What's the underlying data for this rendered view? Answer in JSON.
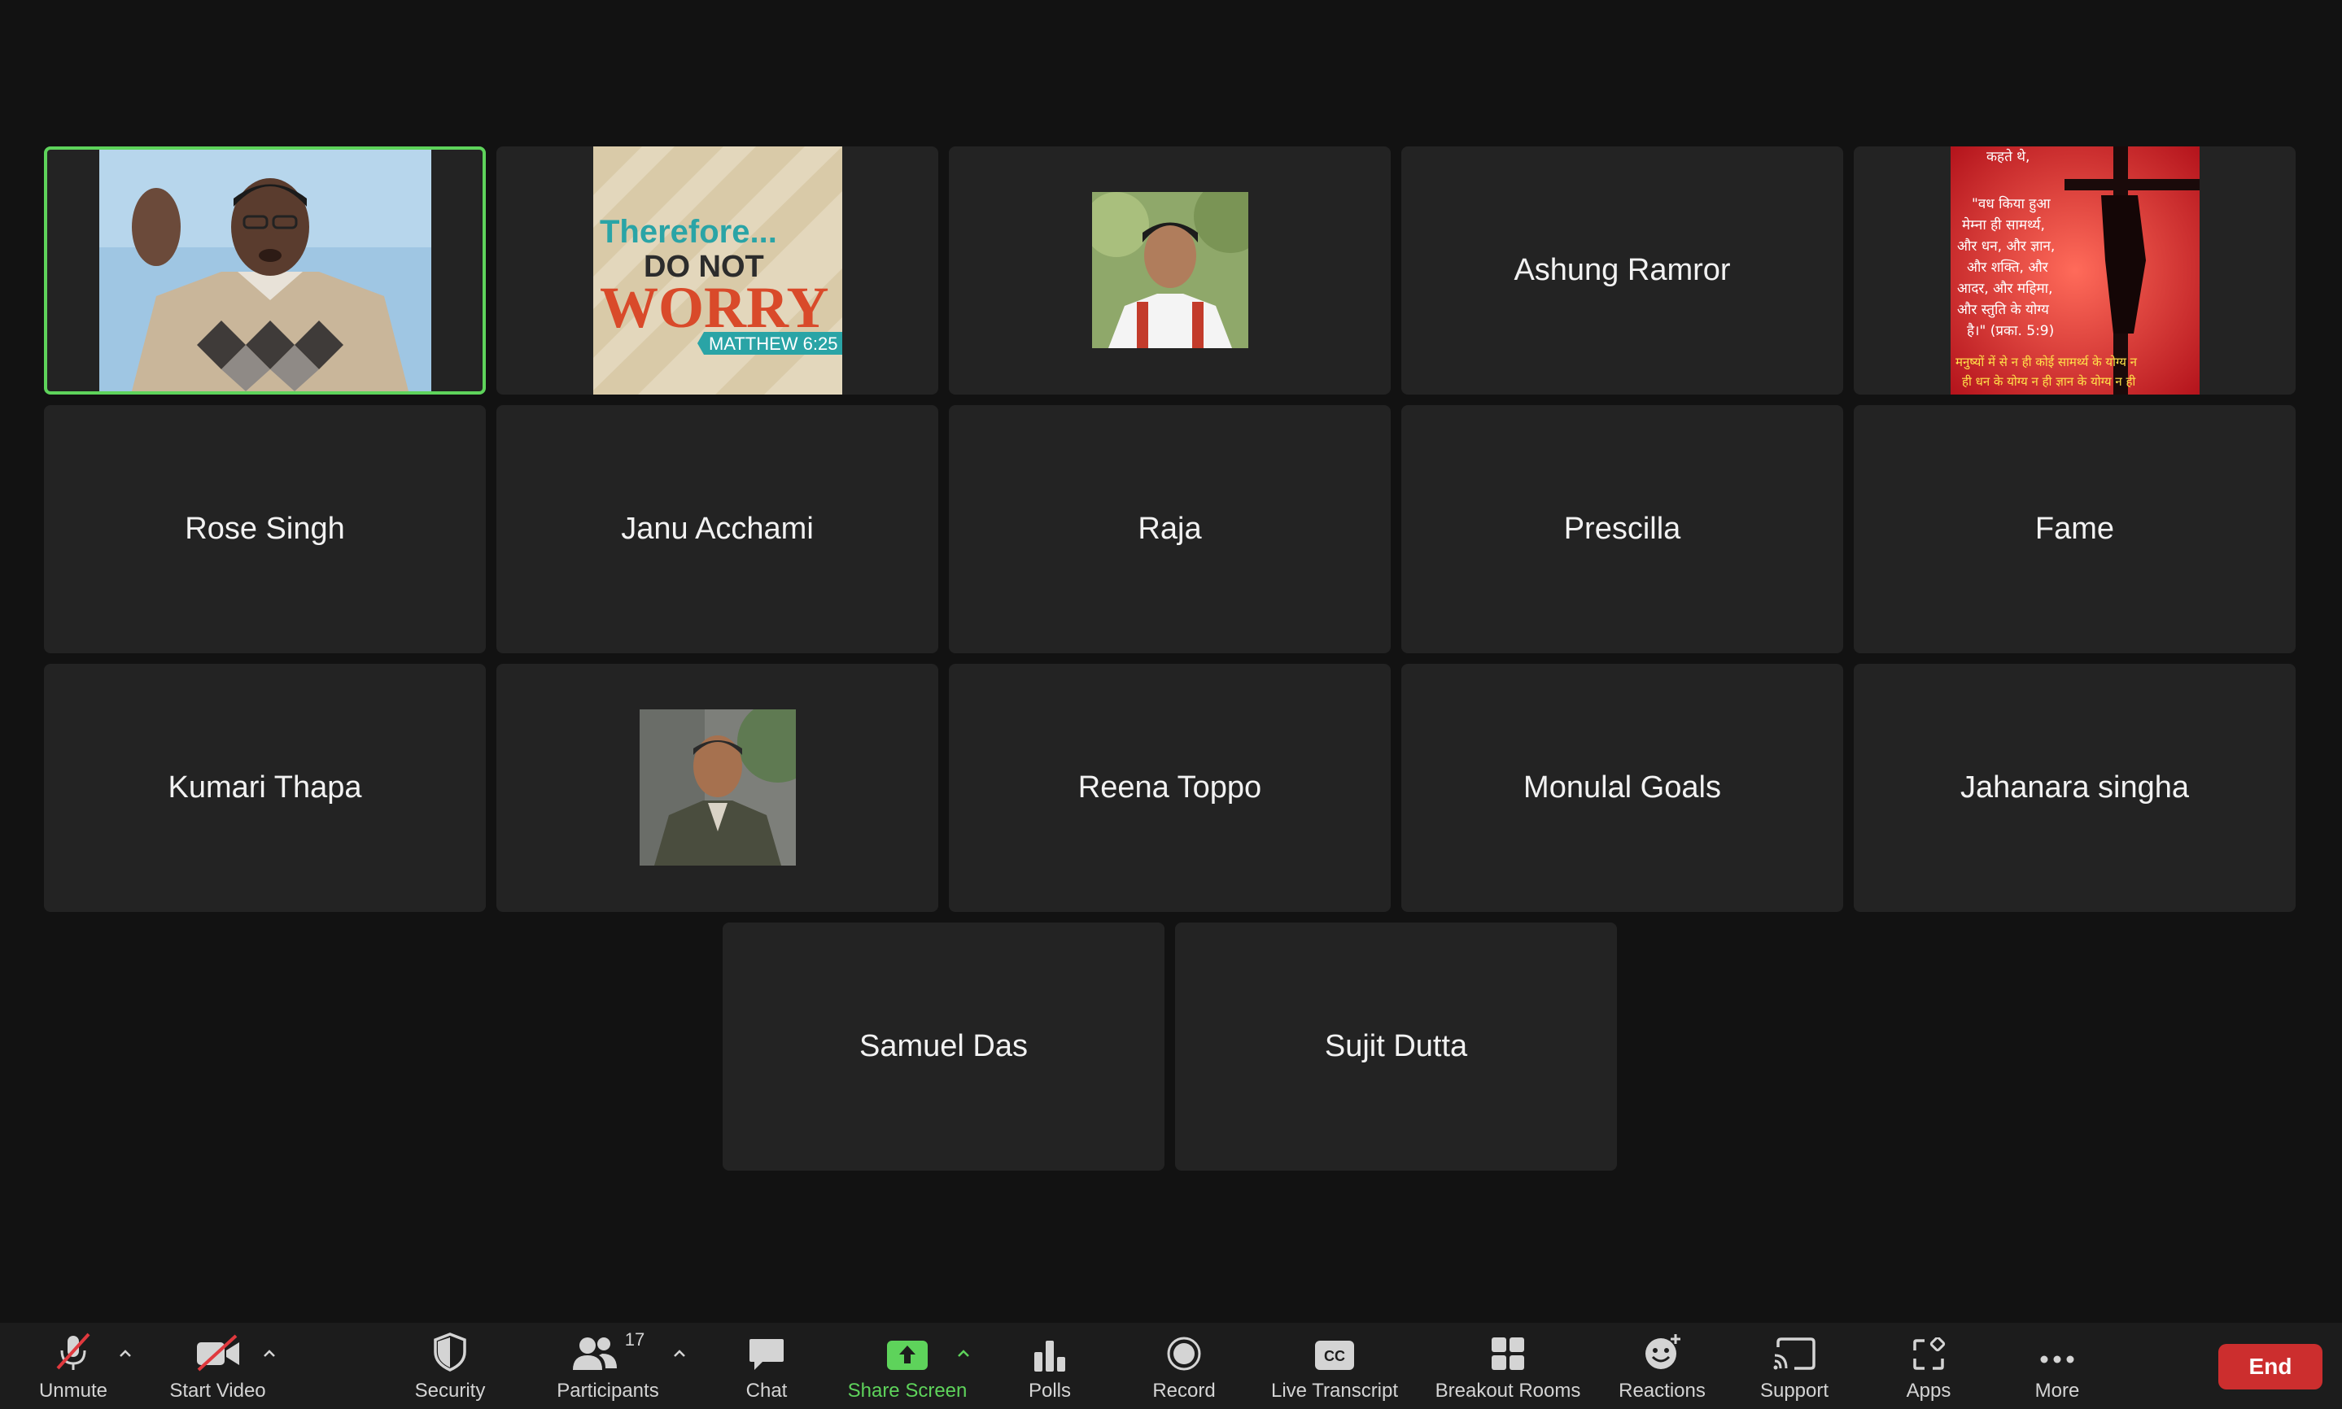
{
  "tiles": {
    "t1_name": "Presenter video",
    "t4": "Ashung Ramror",
    "t6": "Rose Singh",
    "t7": "Janu Acchami",
    "t8": "Raja",
    "t9": "Prescilla",
    "t10": "Fame",
    "t11": "Kumari Thapa",
    "t13": "Reena Toppo",
    "t14": "Monulal Goals",
    "t15": "Jahanara singha",
    "t16": "Samuel Das",
    "t17": "Sujit Dutta"
  },
  "worry": {
    "line1": "Therefore...",
    "line2": "DO NOT",
    "line3": "WORRY",
    "ref": "MATTHEW 6:25"
  },
  "hindi": {
    "l1": "कहते थे,",
    "l2": "\"वध किया हुआ",
    "l3": "मेम्ना ही सामर्थ्य,",
    "l4": "और धन, और ज्ञान,",
    "l5": "और शक्ति, और",
    "l6": "आदर, और महिमा,",
    "l7": "और स्तुति के योग्य",
    "l8": "है।\" (प्रका. 5:9)",
    "l9": "मनुष्यों में से न ही कोई सामर्थ्य के योग्य न",
    "l10": "ही धन के योग्य न ही ज्ञान के योग्य न ही"
  },
  "toolbar": {
    "unmute": "Unmute",
    "start_video": "Start Video",
    "security": "Security",
    "participants": "Participants",
    "participants_count": "17",
    "chat": "Chat",
    "share_screen": "Share Screen",
    "polls": "Polls",
    "record": "Record",
    "live_transcript": "Live Transcript",
    "breakout_rooms": "Breakout Rooms",
    "reactions": "Reactions",
    "support": "Support",
    "apps": "Apps",
    "more": "More",
    "end": "End",
    "cc_text": "CC"
  },
  "colors": {
    "active_border": "#5ed35b",
    "end_button": "#cc2e2e",
    "share_green": "#5ed35b"
  }
}
